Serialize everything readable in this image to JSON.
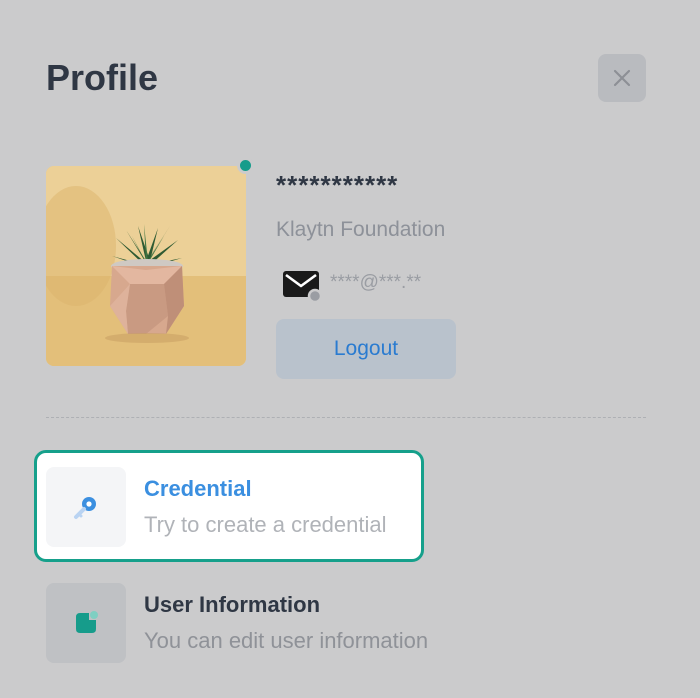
{
  "header": {
    "title": "Profile"
  },
  "profile": {
    "username": "***********",
    "organization": "Klaytn Foundation",
    "email": "****@***.**",
    "logout_label": "Logout",
    "status_color": "#169c8b"
  },
  "menu": {
    "items": [
      {
        "title": "Credential",
        "subtitle": "Try to create a credential",
        "icon": "key-icon",
        "selected": true
      },
      {
        "title": "User Information",
        "subtitle": "You can edit user information",
        "icon": "user-info-icon",
        "selected": false
      }
    ]
  },
  "colors": {
    "accent": "#16a08b",
    "link_blue": "#3b8fe0",
    "overlay": "#cbcbcc"
  }
}
